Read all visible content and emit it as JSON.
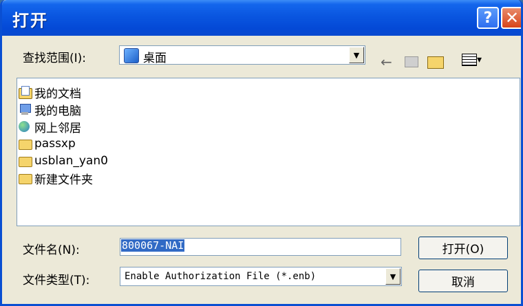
{
  "window": {
    "title": "打开"
  },
  "lookin": {
    "label": "查找范围(I):",
    "value": "桌面"
  },
  "files": [
    {
      "name": "我的文档",
      "icon": "my-documents-icon"
    },
    {
      "name": "我的电脑",
      "icon": "my-computer-icon"
    },
    {
      "name": "网上邻居",
      "icon": "network-places-icon"
    },
    {
      "name": "passxp",
      "icon": "folder-icon"
    },
    {
      "name": "usblan_yan0",
      "icon": "folder-icon"
    },
    {
      "name": "新建文件夹",
      "icon": "folder-icon"
    }
  ],
  "filename": {
    "label": "文件名(N):",
    "value": "800067-NAI"
  },
  "filetype": {
    "label": "文件类型(T):",
    "value": "Enable Authorization File (*.enb)"
  },
  "buttons": {
    "open": "打开(O)",
    "cancel": "取消"
  },
  "colors": {
    "titlebar": "#0a56e0",
    "selection": "#316ac5",
    "dialog_bg": "#ece9d8"
  }
}
